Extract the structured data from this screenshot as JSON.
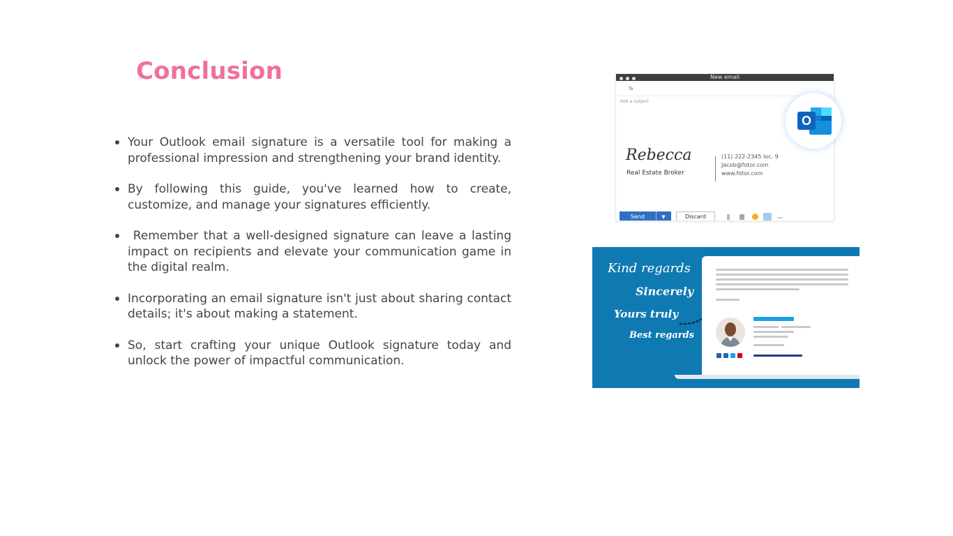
{
  "slide": {
    "title": "Conclusion",
    "bullets": [
      "Your Outlook email signature is a versatile tool for making a professional impression and strengthening your brand identity.",
      "By following this guide, you've learned how to create, customize, and manage your signatures efficiently.",
      " Remember that a well-designed signature can leave a lasting impact on recipients and elevate your communication game in the digital realm.",
      "Incorporating an email signature isn't just about sharing contact details; it's about making a statement.",
      "So, start crafting your unique Outlook signature today and unlock the power of impactful communication."
    ]
  },
  "figure_outlook": {
    "window_title": "New email",
    "to_label": "To",
    "subject_placeholder": "Add a subject",
    "signature_name": "Rebecca",
    "signature_role": "Real Estate Broker",
    "phone": "(11) 222-2345 loc. 9",
    "email": "Jacob@fotor.com",
    "website": "www.fotor.com",
    "send_label": "Send",
    "discard_label": "Discard",
    "logo_letter": "O",
    "icons": [
      "attach-icon",
      "image-icon",
      "emoji-icon",
      "signature-icon",
      "more-icon",
      "outlook-logo-icon",
      "send-dropdown-icon"
    ],
    "colors": {
      "send": "#2f70c0",
      "outlook_blue": "#1e74d6"
    }
  },
  "figure_signature": {
    "sign_offs": [
      "Kind regards",
      "Sincerely",
      "Yours truly",
      "Best regards"
    ],
    "colors": {
      "background": "#0f79b1",
      "accent": "#1ea0e0",
      "link_bar": "#1a3c8f"
    },
    "social_icons": [
      "facebook-icon",
      "linkedin-icon",
      "twitter-icon",
      "pinterest-icon"
    ]
  }
}
